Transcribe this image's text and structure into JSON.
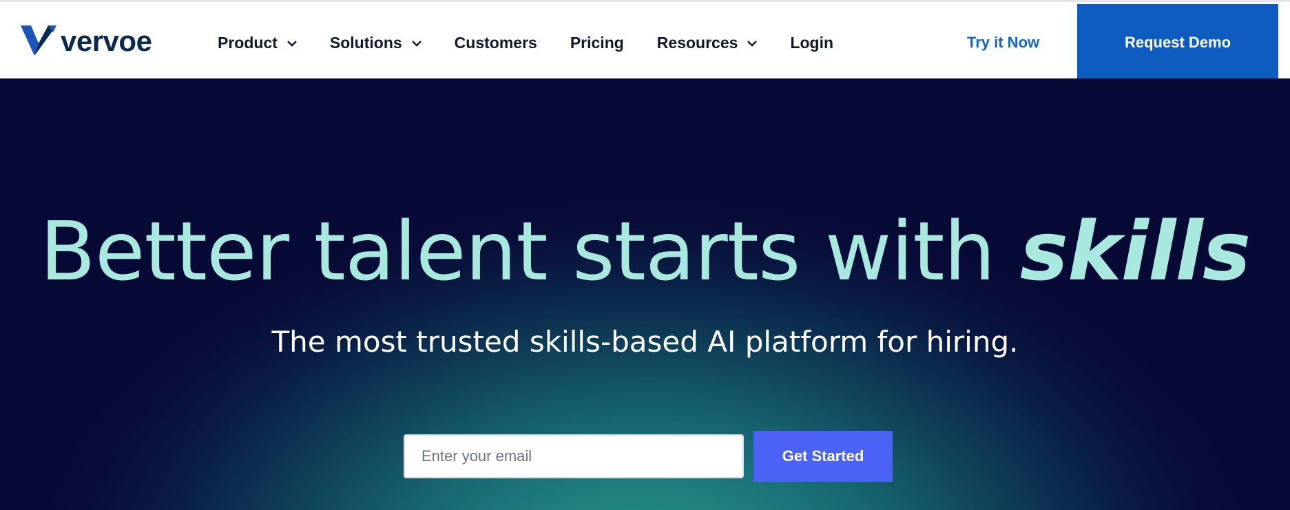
{
  "header": {
    "logo_text": "vervoe",
    "nav": [
      {
        "label": "Product",
        "has_dropdown": true
      },
      {
        "label": "Solutions",
        "has_dropdown": true
      },
      {
        "label": "Customers",
        "has_dropdown": false
      },
      {
        "label": "Pricing",
        "has_dropdown": false
      },
      {
        "label": "Resources",
        "has_dropdown": true
      },
      {
        "label": "Login",
        "has_dropdown": false
      }
    ],
    "try_now_label": "Try it Now",
    "request_demo_label": "Request Demo"
  },
  "hero": {
    "title_main": "Better talent starts with ",
    "title_emphasis": "skills",
    "subtitle": "The most trusted skills-based AI platform for hiring.",
    "email_placeholder": "Enter your email",
    "email_value": "",
    "cta_label": "Get Started"
  },
  "colors": {
    "brand_navy": "#0b2a4e",
    "brand_blue": "#0f5cc0",
    "link_blue": "#1463c6",
    "hero_bg": "#070a35",
    "hero_title": "#a9e8df",
    "cta": "#4a63f5"
  },
  "icons": {
    "logo_mark": "vervoe-v-icon",
    "dropdown": "chevron-down-icon"
  }
}
